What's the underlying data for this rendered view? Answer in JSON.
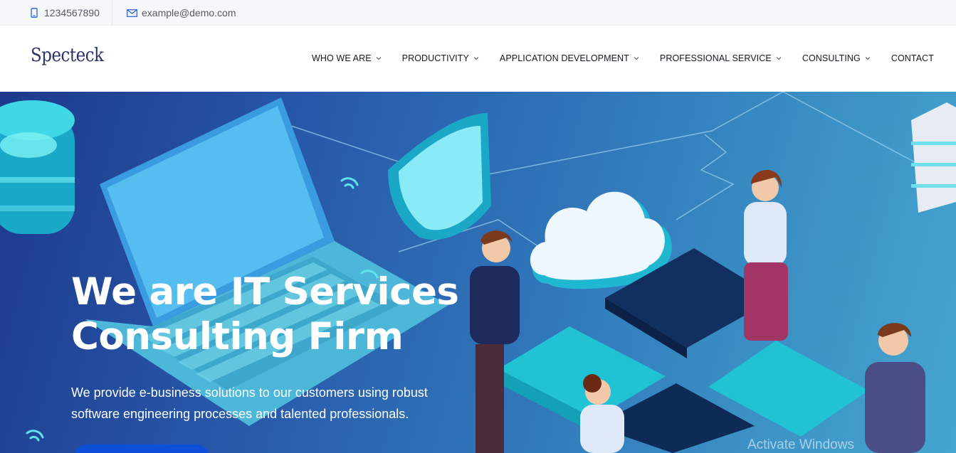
{
  "topbar": {
    "phone": "1234567890",
    "email": "example@demo.com",
    "phone_icon": "phone-icon",
    "email_icon": "envelope-icon"
  },
  "header": {
    "logo": "Specteck",
    "nav": [
      {
        "label": "WHO WE ARE",
        "has_dropdown": true
      },
      {
        "label": "PRODUCTIVITY",
        "has_dropdown": true
      },
      {
        "label": "APPLICATION DEVELOPMENT",
        "has_dropdown": true
      },
      {
        "label": "PROFESSIONAL SERVICE",
        "has_dropdown": true
      },
      {
        "label": "CONSULTING",
        "has_dropdown": true
      },
      {
        "label": "CONTACT",
        "has_dropdown": false
      }
    ]
  },
  "hero": {
    "title_line1": "We are IT Services",
    "title_line2": "Consulting Firm",
    "subtitle_line1": "We provide e-business solutions to our customers using robust",
    "subtitle_line2": "software engineering processes and talented professionals."
  },
  "system": {
    "watermark": "Activate Windows"
  },
  "colors": {
    "brand": "#2a3266",
    "hero_start": "#1d3a8c",
    "hero_end": "#46a6cf",
    "cta": "#0d4fd8"
  }
}
